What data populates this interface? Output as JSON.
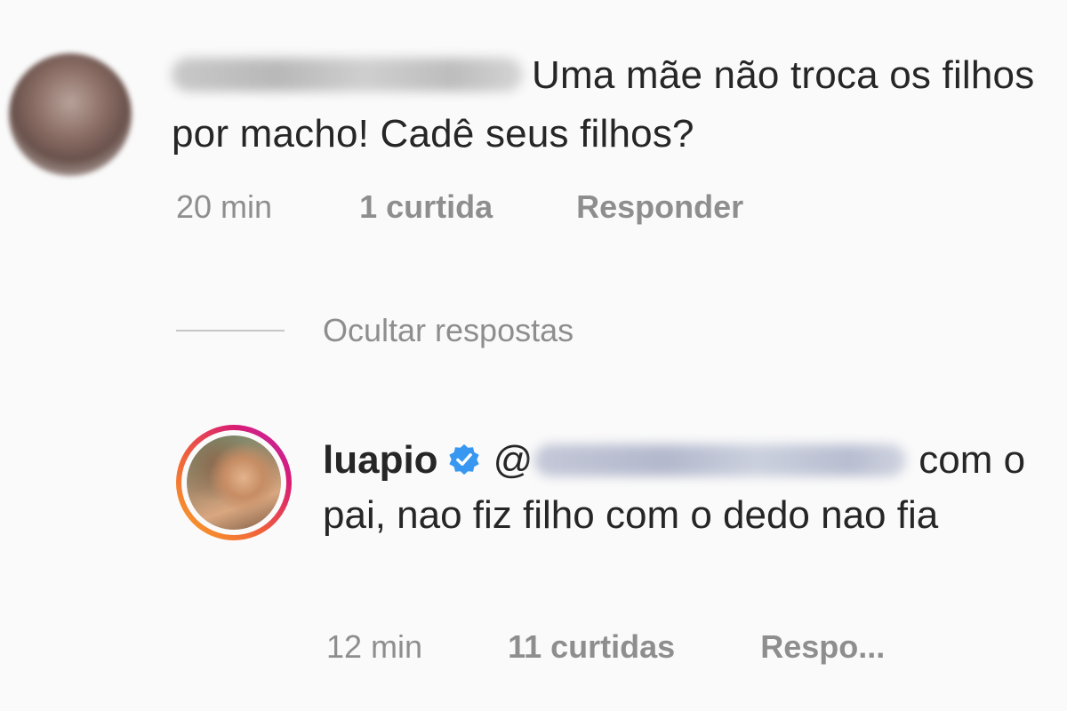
{
  "comment": {
    "text": "Uma mãe não troca os filhos por macho! Cadê seus filhos?",
    "time": "20 min",
    "likes": "1 curtida",
    "reply_label": "Responder"
  },
  "replies_toggle": {
    "label": "Ocultar respostas"
  },
  "reply": {
    "username": "luapio",
    "verified_icon": "verified-badge-icon",
    "mention_prefix": "@",
    "text": "com o pai, nao fiz filho com o dedo nao fia",
    "time": "12 min",
    "likes": "11 curtidas",
    "reply_label": "Respo..."
  },
  "colors": {
    "text": "#262626",
    "muted": "#8e8e8e",
    "verified": "#3897f0",
    "background": "#fafafa"
  }
}
